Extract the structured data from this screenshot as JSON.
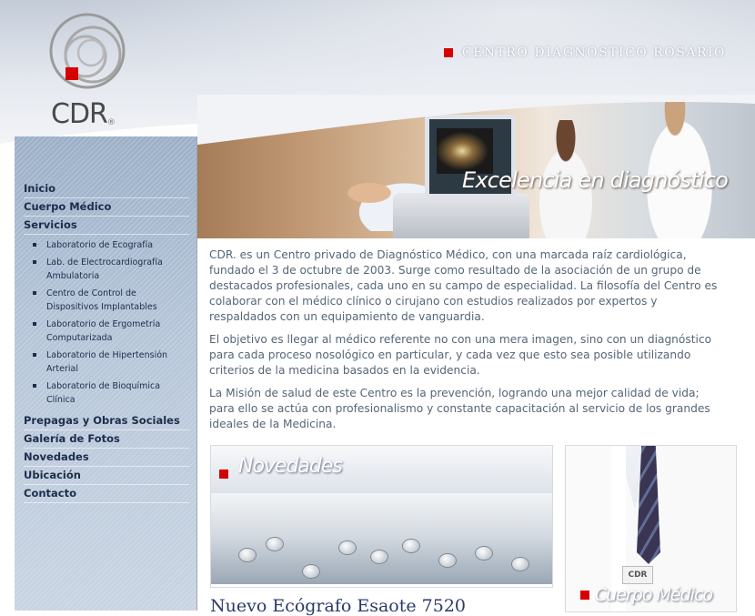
{
  "header": {
    "logo_text": "CDR",
    "logo_reg": "®",
    "site_title": "CENTRO DIAGNOSTICO ROSARIO"
  },
  "banner": {
    "tagline": "Excelencia en diagnóstico"
  },
  "nav": {
    "items": [
      {
        "label": "Inicio"
      },
      {
        "label": "Cuerpo Médico"
      },
      {
        "label": "Servicios"
      },
      {
        "label": "Prepagas y Obras Sociales"
      },
      {
        "label": "Galería de Fotos"
      },
      {
        "label": "Novedades"
      },
      {
        "label": "Ubicación"
      },
      {
        "label": "Contacto"
      }
    ],
    "servicios_sub": [
      {
        "label": "Laboratorio de Ecografía"
      },
      {
        "label": "Lab. de Electrocardiografía Ambulatoria"
      },
      {
        "label": "Centro de Control de Dispositivos Implantables"
      },
      {
        "label": "Laboratorio de Ergometría Computarizada"
      },
      {
        "label": "Laboratorio de Hipertensión Arterial"
      },
      {
        "label": "Laboratorio de Bioquímica Clínica"
      }
    ]
  },
  "main": {
    "paragraphs": [
      "CDR. es un Centro privado de Diagnóstico Médico, con una marcada raíz cardiológica, fundado el 3 de octubre de 2003. Surge como resultado de la asociación de un grupo de destacados profesionales, cada uno en su campo de especialidad. La filosofía del Centro es colaborar con el médico clínico o cirujano con estudios realizados por expertos y respaldados con un equipamiento de vanguardia.",
      "El objetivo es llegar al médico referente no con una mera imagen, sino con un diagnóstico para cada proceso nosológico en particular, y cada vez que esto sea posible utilizando criterios de la medicina basados en la evidencia.",
      "La Misión de salud de este Centro es la prevención, logrando una mejor calidad de vida; para ello se actúa con profesionalismo y constante capacitación al servicio de los grandes ideales de la Medicina."
    ]
  },
  "novedades": {
    "title": "Novedades",
    "headline": "Nuevo Ecógrafo Esaote 7520"
  },
  "promo": {
    "title": "Cuerpo Médico",
    "badge": "CDR"
  },
  "colors": {
    "accent_red": "#d50000",
    "nav_text": "#1d2d4a",
    "body_text": "#556677",
    "headline": "#2a3a6a"
  }
}
